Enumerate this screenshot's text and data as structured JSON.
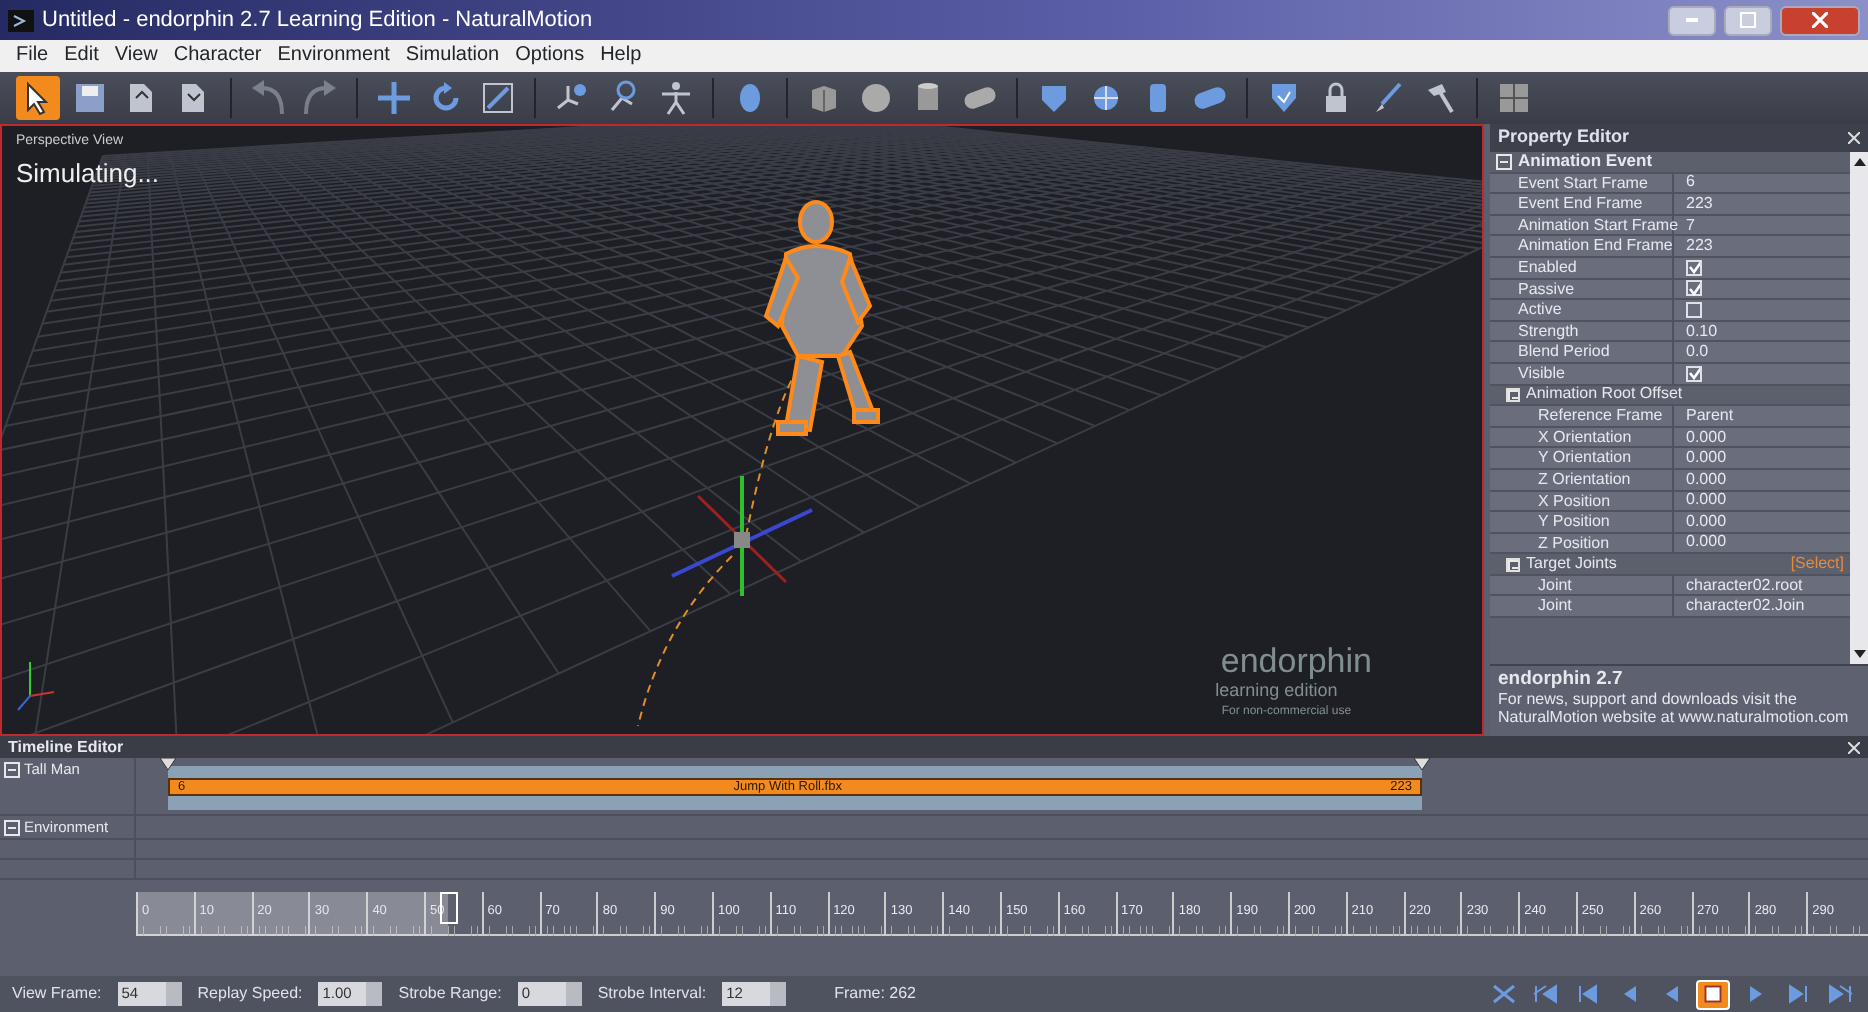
{
  "window": {
    "title": "Untitled - endorphin 2.7 Learning Edition - NaturalMotion"
  },
  "menu": [
    "File",
    "Edit",
    "View",
    "Character",
    "Environment",
    "Simulation",
    "Options",
    "Help"
  ],
  "toolbar": [
    {
      "selected": true,
      "disabled": false
    },
    {
      "selected": false,
      "disabled": false
    },
    {
      "selected": false,
      "disabled": false
    },
    {
      "selected": false,
      "disabled": false
    },
    {
      "selected": false,
      "disabled": true
    },
    {
      "selected": false,
      "disabled": true
    },
    {
      "selected": false,
      "disabled": false
    },
    {
      "selected": false,
      "disabled": false
    },
    {
      "selected": false,
      "disabled": false
    },
    {
      "selected": false,
      "disabled": false
    },
    {
      "selected": false,
      "disabled": false
    },
    {
      "selected": false,
      "disabled": false
    },
    {
      "selected": false,
      "disabled": false
    },
    {
      "selected": false,
      "disabled": false
    },
    {
      "selected": false,
      "disabled": false
    },
    {
      "selected": false,
      "disabled": false
    },
    {
      "selected": false,
      "disabled": false
    },
    {
      "selected": false,
      "disabled": false
    },
    {
      "selected": false,
      "disabled": false
    },
    {
      "selected": false,
      "disabled": false
    },
    {
      "selected": false,
      "disabled": false
    },
    {
      "selected": false,
      "disabled": false
    },
    {
      "selected": false,
      "disabled": false
    },
    {
      "selected": false,
      "disabled": false
    },
    {
      "selected": false,
      "disabled": false
    },
    {
      "selected": false,
      "disabled": false
    }
  ],
  "viewport": {
    "view_label": "Perspective View",
    "status": "Simulating...",
    "logo": "endorphin",
    "edition": "learning edition",
    "note": "For non-commercial use"
  },
  "property_editor": {
    "title": "Property Editor",
    "sections": [
      {
        "label": "Animation Event",
        "expanded": true,
        "children": [
          {
            "kind": "text",
            "label": "Event Start Frame",
            "value": "6"
          },
          {
            "kind": "text",
            "label": "Event End Frame",
            "value": "223"
          },
          {
            "kind": "text",
            "label": "Animation Start Frame",
            "value": "7"
          },
          {
            "kind": "text",
            "label": "Animation End Frame",
            "value": "223"
          },
          {
            "kind": "check",
            "label": "Enabled",
            "checked": true
          },
          {
            "kind": "check",
            "label": "Passive",
            "checked": true
          },
          {
            "kind": "check",
            "label": "Active",
            "checked": false
          },
          {
            "kind": "text",
            "label": "Strength",
            "value": "0.10"
          },
          {
            "kind": "text",
            "label": "Blend Period",
            "value": "0.0"
          },
          {
            "kind": "check",
            "label": "Visible",
            "checked": true
          },
          {
            "kind": "group",
            "label": "Animation Root Offset",
            "expanded": true,
            "children": [
              {
                "kind": "text",
                "label": "Reference Frame",
                "value": "Parent"
              },
              {
                "kind": "text",
                "label": "X Orientation",
                "value": "0.000"
              },
              {
                "kind": "text",
                "label": "Y Orientation",
                "value": "0.000"
              },
              {
                "kind": "text",
                "label": "Z Orientation",
                "value": "0.000"
              },
              {
                "kind": "text",
                "label": "X Position",
                "value": "0.000"
              },
              {
                "kind": "text",
                "label": "Y Position",
                "value": "0.000"
              },
              {
                "kind": "text",
                "label": "Z Position",
                "value": "0.000"
              }
            ]
          },
          {
            "kind": "group",
            "label": "Target Joints",
            "expanded": true,
            "action": "[Select]",
            "children": [
              {
                "kind": "text",
                "label": "Joint",
                "value": "character02.root"
              },
              {
                "kind": "text",
                "label": "Joint",
                "value": "character02.Join"
              }
            ]
          }
        ]
      }
    ],
    "info_title": "endorphin 2.7",
    "info_text": "For news, support and downloads visit the NaturalMotion website at www.naturalmotion.com"
  },
  "timeline": {
    "title": "Timeline Editor",
    "tracks": [
      {
        "label": "Tall Man",
        "expanded": true,
        "clips": [
          {
            "start": "6",
            "name": "Jump With Roll.fbx",
            "end": "223"
          }
        ]
      },
      {
        "label": "Environment",
        "expanded": true
      }
    ],
    "ruler": {
      "labels": [
        "0",
        "10",
        "20",
        "30",
        "40",
        "50",
        "60",
        "70",
        "80",
        "90",
        "100",
        "110",
        "120",
        "130",
        "140",
        "150",
        "160",
        "170",
        "180",
        "190",
        "200",
        "210",
        "220",
        "230",
        "240",
        "250",
        "260",
        "270",
        "280",
        "290"
      ],
      "level": 0.18
    }
  },
  "status_bar": {
    "fields": [
      {
        "label": "View Frame:",
        "value": "54"
      },
      {
        "label": "Replay Speed:",
        "value": "1.00"
      },
      {
        "label": "Strobe Range:",
        "value": "0"
      },
      {
        "label": "Strobe Interval:",
        "value": "12"
      }
    ],
    "frame": "Frame: 262",
    "transport": [
      {
        "selected": false
      },
      {
        "selected": false
      },
      {
        "selected": false
      },
      {
        "selected": false
      },
      {
        "selected": false
      },
      {
        "selected": true
      },
      {
        "selected": false
      },
      {
        "selected": false
      },
      {
        "selected": false
      }
    ]
  }
}
